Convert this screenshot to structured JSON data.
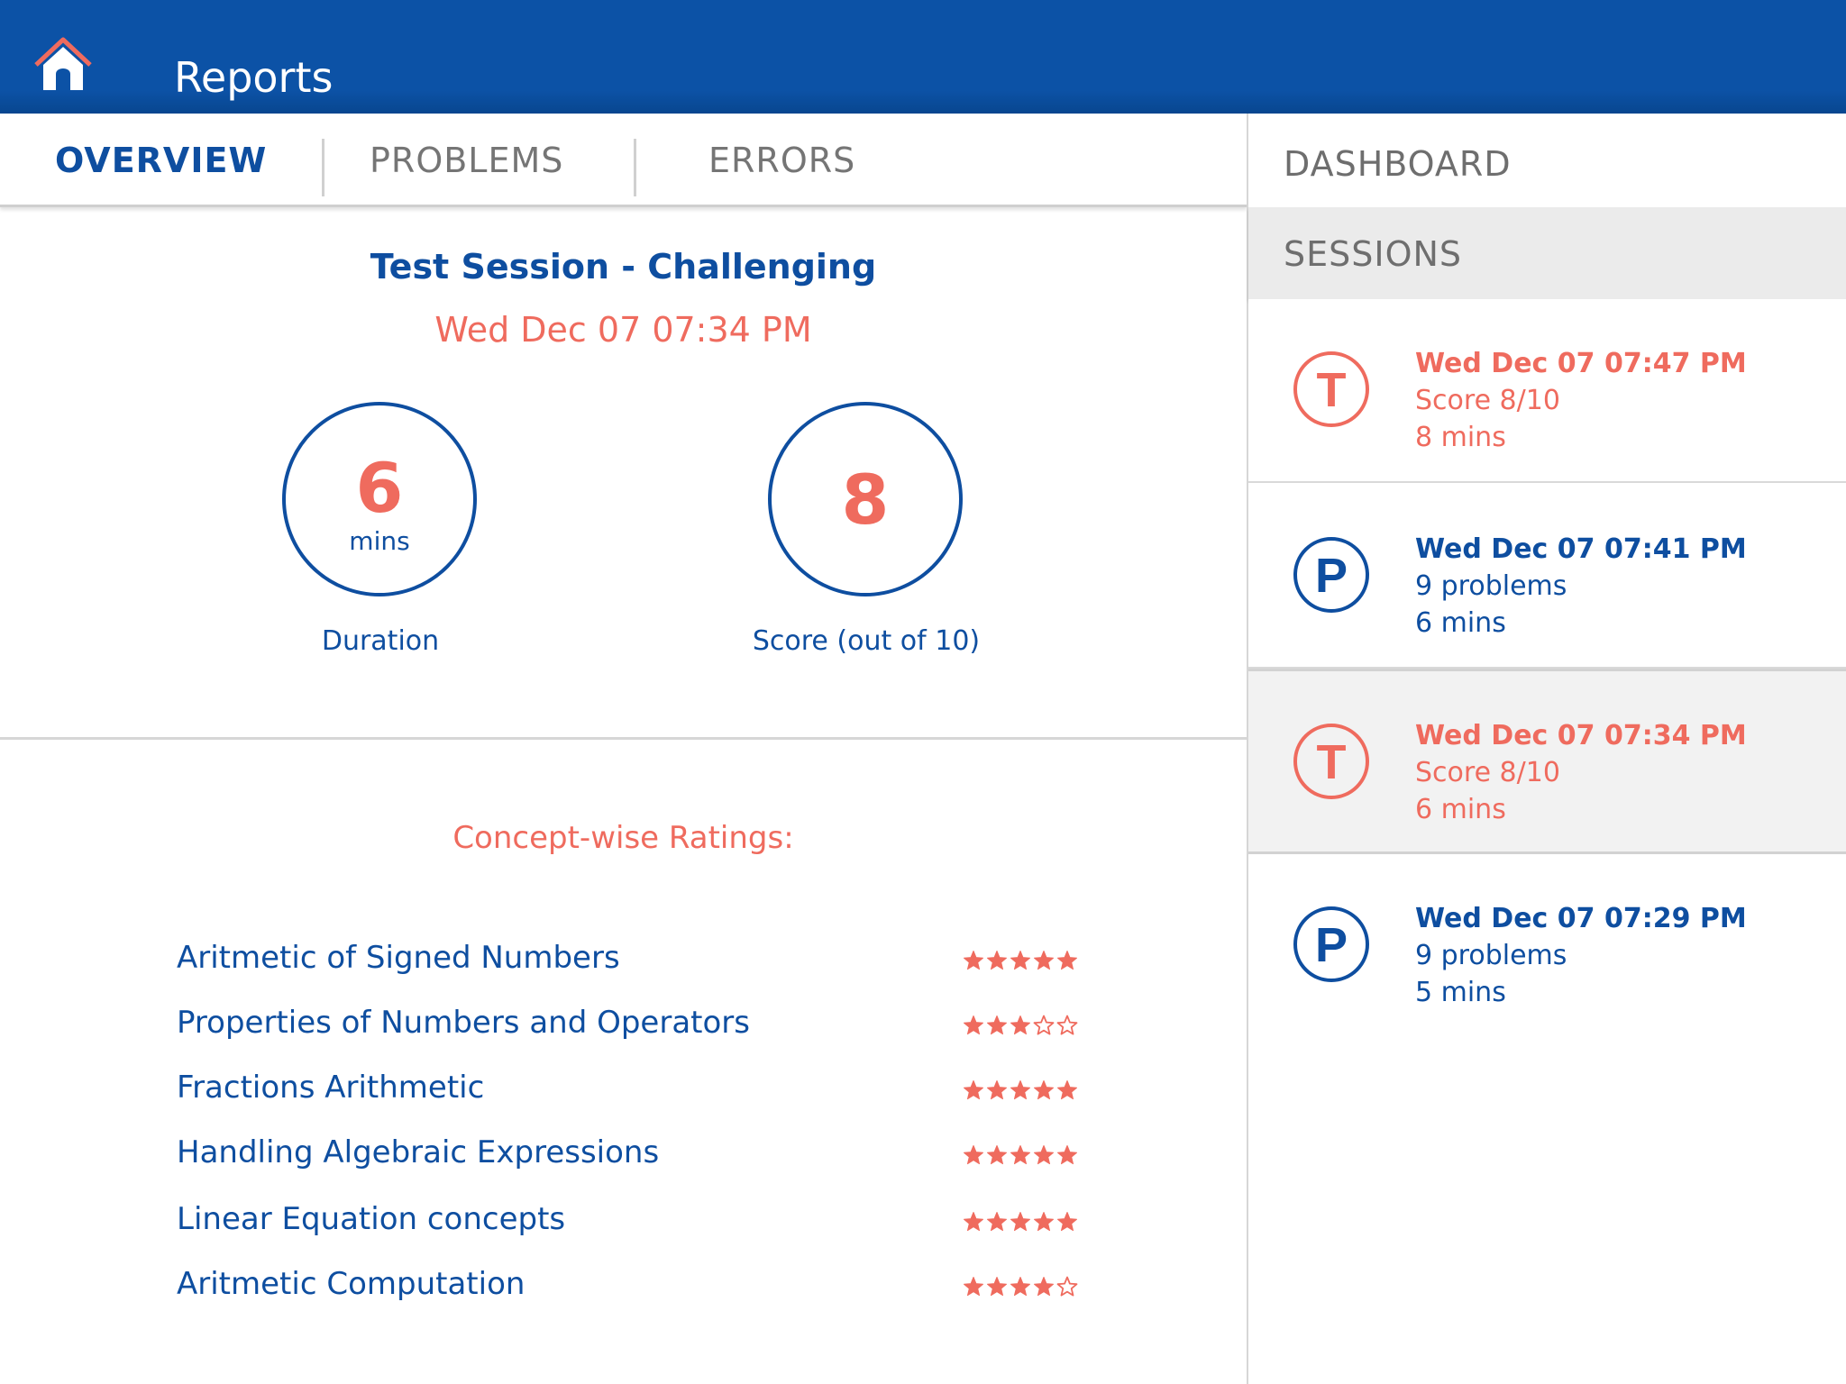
{
  "header": {
    "title": "Reports",
    "home_icon": "home-icon",
    "bg_color": "#0c52a6"
  },
  "tabs": [
    {
      "label": "OVERVIEW",
      "active": true
    },
    {
      "label": "PROBLEMS",
      "active": false
    },
    {
      "label": "ERRORS",
      "active": false
    }
  ],
  "overview": {
    "session_title": "Test Session - Challenging",
    "session_date": "Wed Dec 07 07:34 PM",
    "duration": {
      "value": "6",
      "unit": "mins",
      "label": "Duration"
    },
    "score": {
      "value": "8",
      "label": "Score (out of 10)"
    },
    "ratings_heading": "Concept-wise Ratings:",
    "concepts": [
      {
        "name": "Aritmetic of Signed Numbers",
        "rating": 5,
        "max": 5
      },
      {
        "name": "Properties of Numbers and Operators",
        "rating": 3,
        "max": 5
      },
      {
        "name": "Fractions Arithmetic",
        "rating": 5,
        "max": 5
      },
      {
        "name": "Handling Algebraic Expressions",
        "rating": 5,
        "max": 5
      },
      {
        "name": "Linear Equation concepts",
        "rating": 5,
        "max": 5
      },
      {
        "name": "Aritmetic Computation",
        "rating": 4,
        "max": 5
      }
    ]
  },
  "sidebar": {
    "dashboard_label": "DASHBOARD",
    "sessions_label": "SESSIONS",
    "sessions": [
      {
        "badge": "T",
        "kind": "test",
        "date": "Wed Dec 07 07:47 PM",
        "detail": "Score 8/10",
        "duration": "8 mins",
        "selected": false
      },
      {
        "badge": "P",
        "kind": "practice",
        "date": "Wed Dec 07 07:41 PM",
        "detail": "9 problems",
        "duration": "6 mins",
        "selected": false
      },
      {
        "badge": "T",
        "kind": "test",
        "date": "Wed Dec 07 07:34 PM",
        "detail": "Score 8/10",
        "duration": "6 mins",
        "selected": true
      },
      {
        "badge": "P",
        "kind": "practice",
        "date": "Wed Dec 07 07:29 PM",
        "detail": "9 problems",
        "duration": "5 mins",
        "selected": false
      }
    ]
  },
  "colors": {
    "primary": "#0e4ea0",
    "accent": "#ef6b5e",
    "muted": "#757575"
  }
}
